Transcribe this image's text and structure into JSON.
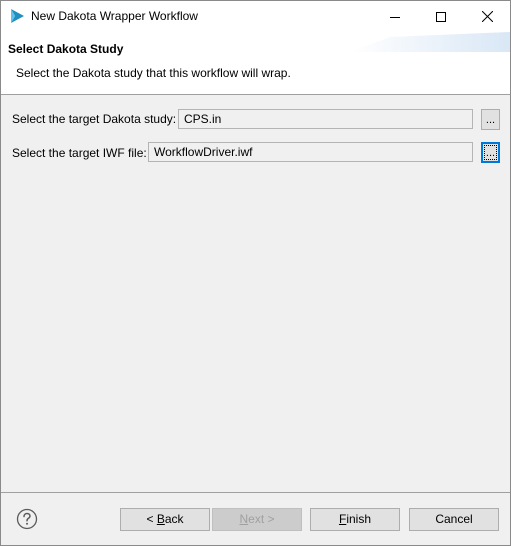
{
  "window": {
    "title": "New Dakota Wrapper Workflow",
    "controls": {
      "minimize": "minimize",
      "maximize": "maximize",
      "close": "close"
    }
  },
  "header": {
    "title": "Select Dakota Study",
    "description": "Select the Dakota study that this workflow will wrap."
  },
  "form": {
    "study": {
      "label": "Select the target Dakota study:",
      "value": "CPS.in",
      "browse_label": "..."
    },
    "iwf": {
      "label": "Select the target IWF file:",
      "value": "WorkflowDriver.iwf",
      "browse_label": "..."
    }
  },
  "footer": {
    "back": {
      "pre": "< ",
      "mnemonic": "B",
      "rest": "ack"
    },
    "next": {
      "mnemonic": "N",
      "rest": "ext >"
    },
    "finish": {
      "mnemonic": "F",
      "rest": "inish"
    },
    "cancel": "Cancel"
  },
  "icons": {
    "app": "dakota-play-icon",
    "help": "help-question-icon"
  },
  "colors": {
    "accent": "#0078d7",
    "app_icon": "#1e8fbf",
    "header_deco": "#d9e7f6"
  }
}
